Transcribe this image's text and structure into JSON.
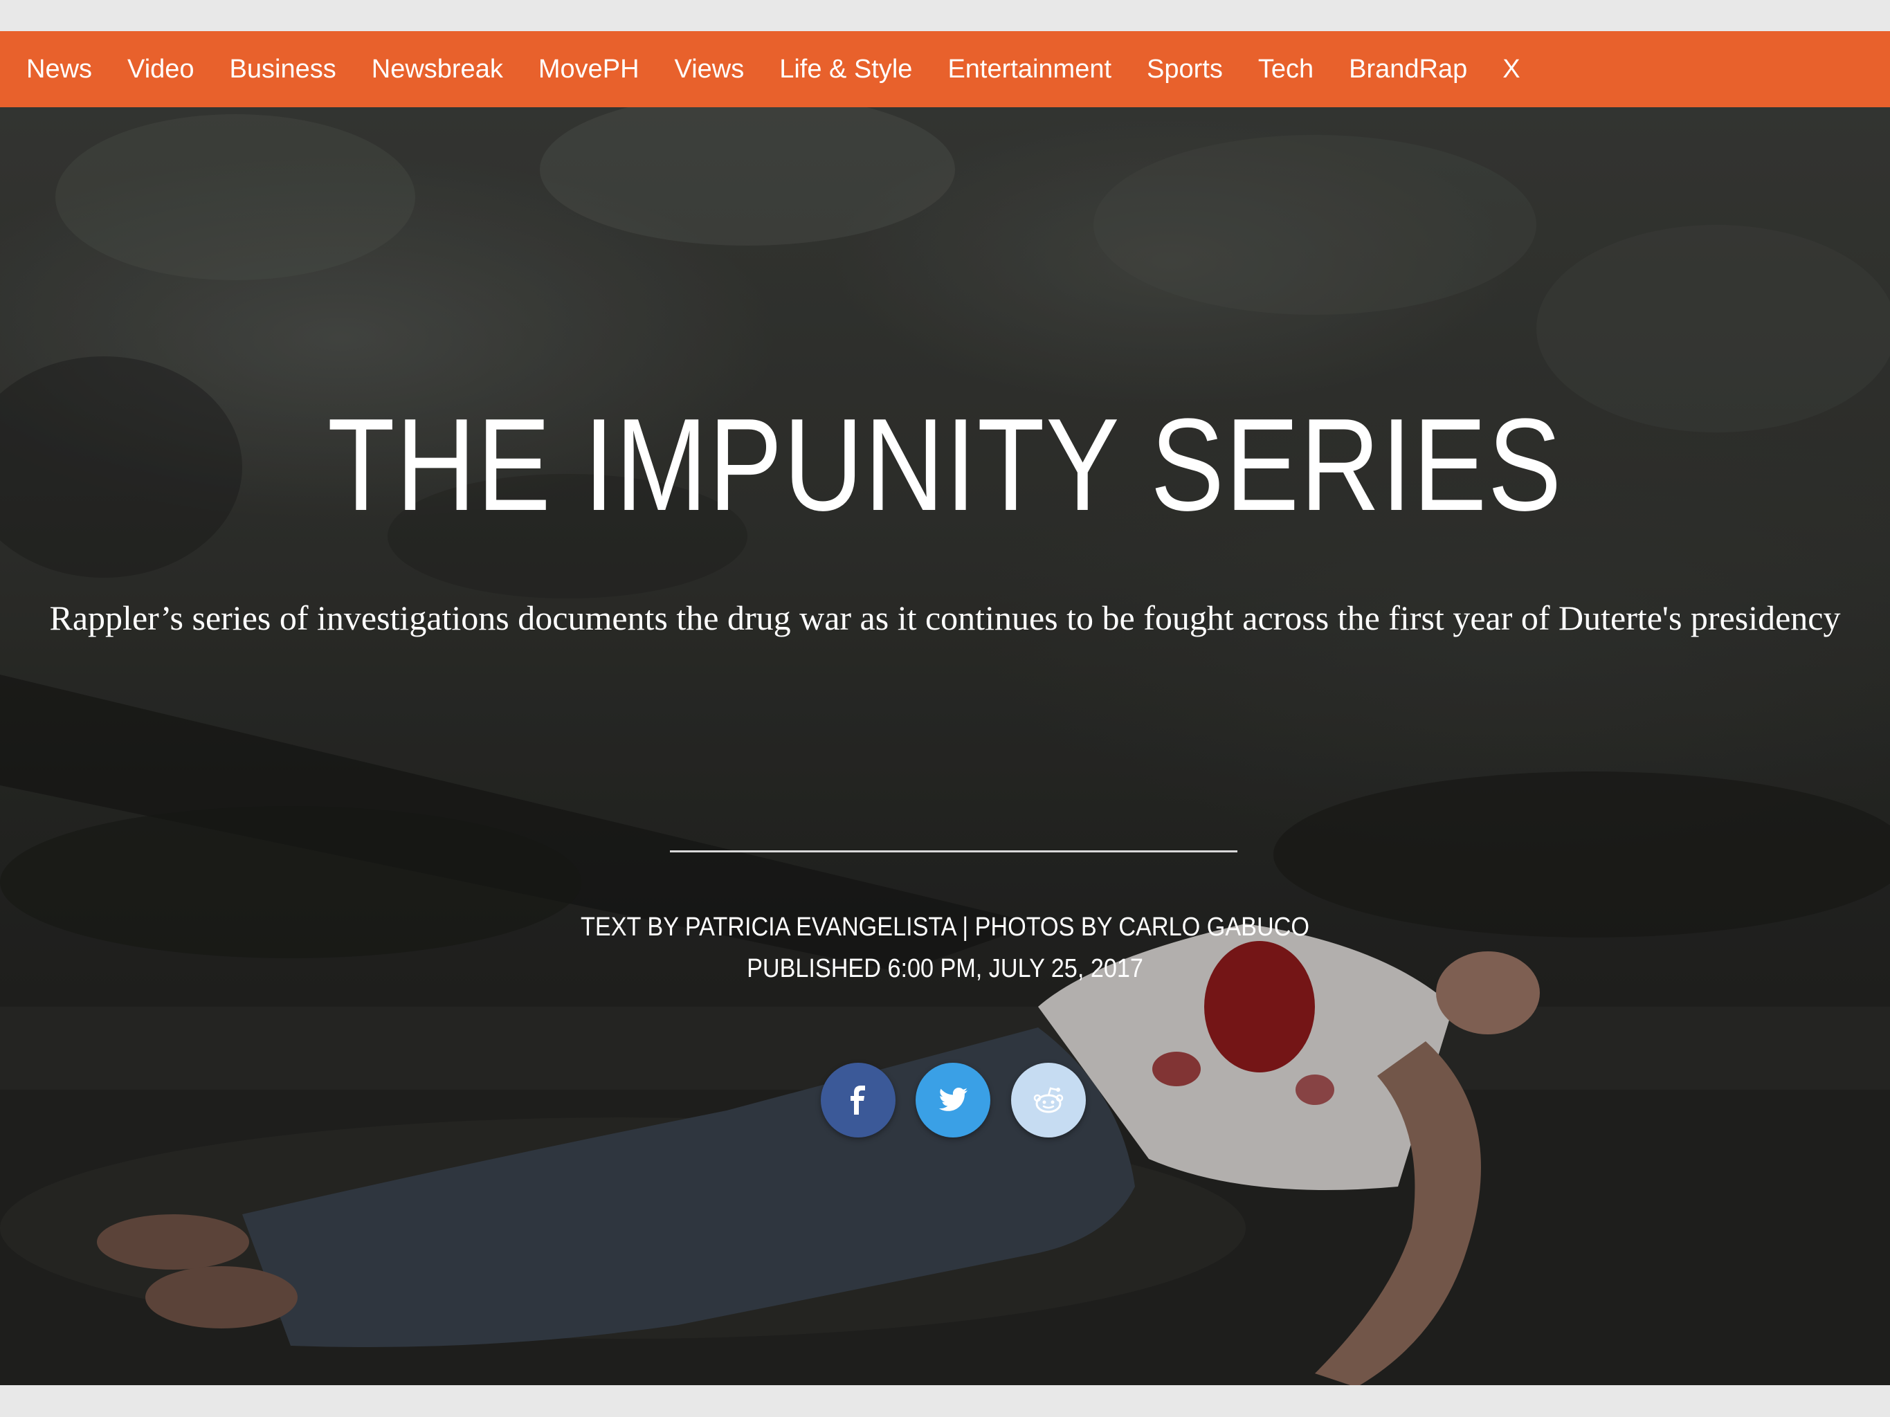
{
  "nav": {
    "items": [
      {
        "label": "News"
      },
      {
        "label": "Video"
      },
      {
        "label": "Business"
      },
      {
        "label": "Newsbreak"
      },
      {
        "label": "MovePH"
      },
      {
        "label": "Views"
      },
      {
        "label": "Life & Style"
      },
      {
        "label": "Entertainment"
      },
      {
        "label": "Sports"
      },
      {
        "label": "Tech"
      },
      {
        "label": "BrandRap"
      }
    ],
    "close_label": "X",
    "background_color": "#e8612c"
  },
  "hero": {
    "title": "THE IMPUNITY SERIES",
    "subtitle": "Rappler’s series of investigations documents the drug war as it continues to be fought across the first year of Duterte's presidency",
    "byline": "TEXT BY PATRICIA EVANGELISTA | PHOTOS BY CARLO GABUCO",
    "published": "PUBLISHED 6:00 PM, JULY 25, 2017"
  },
  "share": {
    "buttons": [
      {
        "icon": "facebook-icon",
        "color": "#3b5998"
      },
      {
        "icon": "twitter-icon",
        "color": "#3aa0e6"
      },
      {
        "icon": "reddit-icon",
        "color": "#c6dcf2"
      }
    ]
  }
}
